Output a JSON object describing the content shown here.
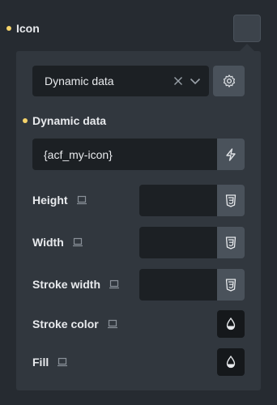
{
  "header": {
    "label": "Icon"
  },
  "source_select": {
    "value": "Dynamic data"
  },
  "dynamic_section": {
    "label": "Dynamic data",
    "value": "{acf_my-icon}"
  },
  "fields": {
    "height": "Height",
    "width": "Width",
    "stroke_width": "Stroke width",
    "stroke_color": "Stroke color",
    "fill": "Fill"
  },
  "colors": {
    "accent_dot": "#f5d36a",
    "panel": "#31373e",
    "input_bg": "#1c2024"
  }
}
